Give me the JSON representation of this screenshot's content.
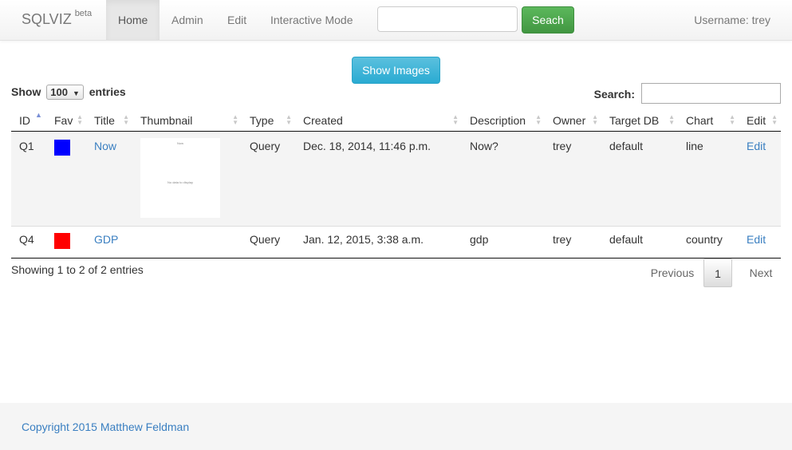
{
  "navbar": {
    "brand": "SQLVIZ",
    "brand_sup": "beta",
    "items": [
      {
        "label": "Home"
      },
      {
        "label": "Admin"
      },
      {
        "label": "Edit"
      },
      {
        "label": "Interactive Mode"
      }
    ],
    "search_placeholder": "",
    "search_button": "Seach",
    "username": "Username: trey"
  },
  "show_images_label": "Show Images",
  "length": {
    "prefix": "Show",
    "value": "100",
    "suffix": "entries"
  },
  "filter": {
    "label": "Search:",
    "value": ""
  },
  "table": {
    "headers": [
      "ID",
      "Fav",
      "Title",
      "Thumbnail",
      "Type",
      "Created",
      "Description",
      "Owner",
      "Target DB",
      "Chart",
      "Edit"
    ],
    "rows": [
      {
        "id": "Q1",
        "fav_color": "#0000ff",
        "title": "Now",
        "thumb_top": "Now",
        "thumb_mid": "No data to display",
        "type": "Query",
        "created": "Dec. 18, 2014, 11:46 p.m.",
        "description": "Now?",
        "owner": "trey",
        "target_db": "default",
        "chart": "line",
        "edit": "Edit"
      },
      {
        "id": "Q4",
        "fav_color": "#ff0000",
        "title": "GDP",
        "type": "Query",
        "created": "Jan. 12, 2015, 3:38 a.m.",
        "description": "gdp",
        "owner": "trey",
        "target_db": "default",
        "chart": "country",
        "edit": "Edit"
      }
    ]
  },
  "info": "Showing 1 to 2 of 2 entries",
  "pager": {
    "previous": "Previous",
    "page": "1",
    "next": "Next"
  },
  "footer": "Copyright 2015 Matthew Feldman"
}
